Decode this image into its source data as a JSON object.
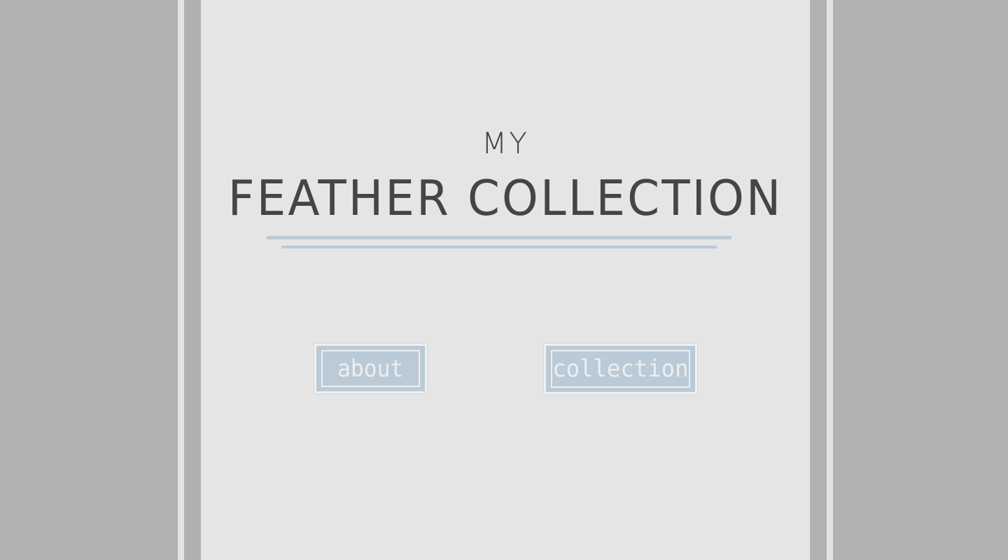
{
  "title": {
    "kicker": "my",
    "main": "feather collection"
  },
  "nav": {
    "about_label": "about",
    "collection_label": "collection"
  },
  "colors": {
    "background": "#b1b1b1",
    "panel": "#e5e5e5",
    "accent": "#bacad6",
    "title_text": "#454545",
    "button_text": "#eceeef"
  }
}
